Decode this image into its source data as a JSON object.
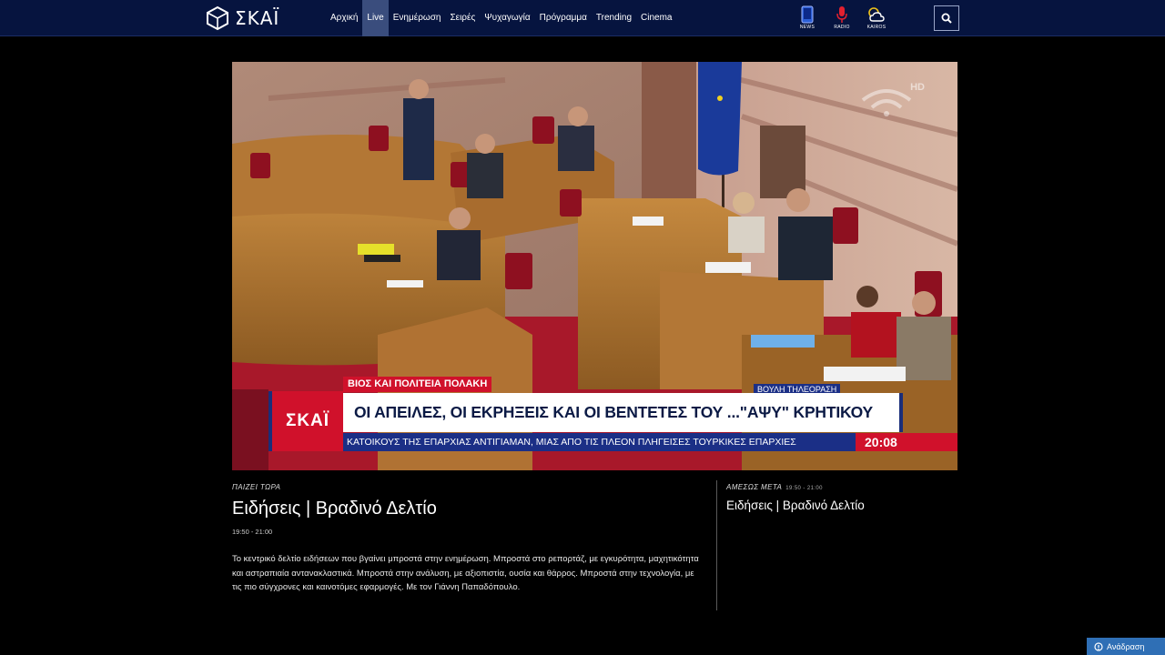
{
  "brand": {
    "logo_text": "ΣΚΑΪ"
  },
  "nav": {
    "items": [
      {
        "label": "Αρχική",
        "active": false
      },
      {
        "label": "Live",
        "active": true
      },
      {
        "label": "Ενημέρωση",
        "active": false
      },
      {
        "label": "Σειρές",
        "active": false
      },
      {
        "label": "Ψυχαγωγία",
        "active": false
      },
      {
        "label": "Πρόγραμμα",
        "active": false
      },
      {
        "label": "Trending",
        "active": false
      },
      {
        "label": "Cinema",
        "active": false
      }
    ]
  },
  "quick_links": [
    {
      "label": "NEWS",
      "icon": "phone-icon"
    },
    {
      "label": "RADIO",
      "icon": "microphone-icon"
    },
    {
      "label": "KAIROS",
      "icon": "weather-icon"
    }
  ],
  "search": {
    "icon": "search-icon"
  },
  "player": {
    "hd_badge": "HD",
    "kicker": "ΒΙΟΣ ΚΑΙ ΠΟΛΙΤΕΙΑ ΠΟΛΑΚΗ",
    "brand_box": "ΣΚΑΪ",
    "headline": "ΟΙ ΑΠΕΙΛΕΣ, ΟΙ ΕΚΡΗΞΕΙΣ ΚΑΙ ΟΙ ΒΕΝΤΕΤΕΣ ΤΟΥ ...\"ΑΨΥ\" ΚΡΗΤΙΚΟΥ",
    "ticker": "ΚΑΤΟΙΚΟΥΣ ΤΗΣ ΕΠΑΡΧΙΑΣ ΑΝΤΙΓΙΑΜΑΝ, ΜΙΑΣ ΑΠΟ ΤΙΣ ΠΛΕΟΝ ΠΛΗΓΕΙΣΕΣ ΤΟΥΡΚΙΚΕΣ ΕΠΑΡΧΙΕΣ",
    "clock": "20:08",
    "source_tag": "ΒΟΥΛΗ ΤΗΛΕΟΡΑΣΗ"
  },
  "now": {
    "label": "ΠΑΙΖΕΙ ΤΩΡΑ",
    "title": "Ειδήσεις | Βραδινό Δελτίο",
    "time": "19:50 - 21:00",
    "description": "Το κεντρικό δελτίο ειδήσεων που βγαίνει μπροστά στην ενημέρωση. Μπροστά στο ρεπορτάζ, με εγκυρότητα, μαχητικότητα και αστραπιαία αντανακλαστικά. Μπροστά στην ανάλυση, με αξιοπιστία, ουσία και θάρρος. Μπροστά στην τεχνολογία, με τις πιο σύγχρονες και καινοτόμες εφαρμογές. Με τον Γιάννη Παπαδόπουλο."
  },
  "next": {
    "label": "ΑΜΕΣΩΣ ΜΕΤΑ",
    "time": "19:50 - 21:00",
    "title": "Ειδήσεις | Βραδινό Δελτίο"
  },
  "feedback": {
    "label": "Ανάδραση"
  },
  "colors": {
    "nav_bg": "#06143f",
    "accent_red": "#d0112b",
    "ticker_blue": "#1b2f86",
    "feedback_blue": "#2f6fb5"
  }
}
